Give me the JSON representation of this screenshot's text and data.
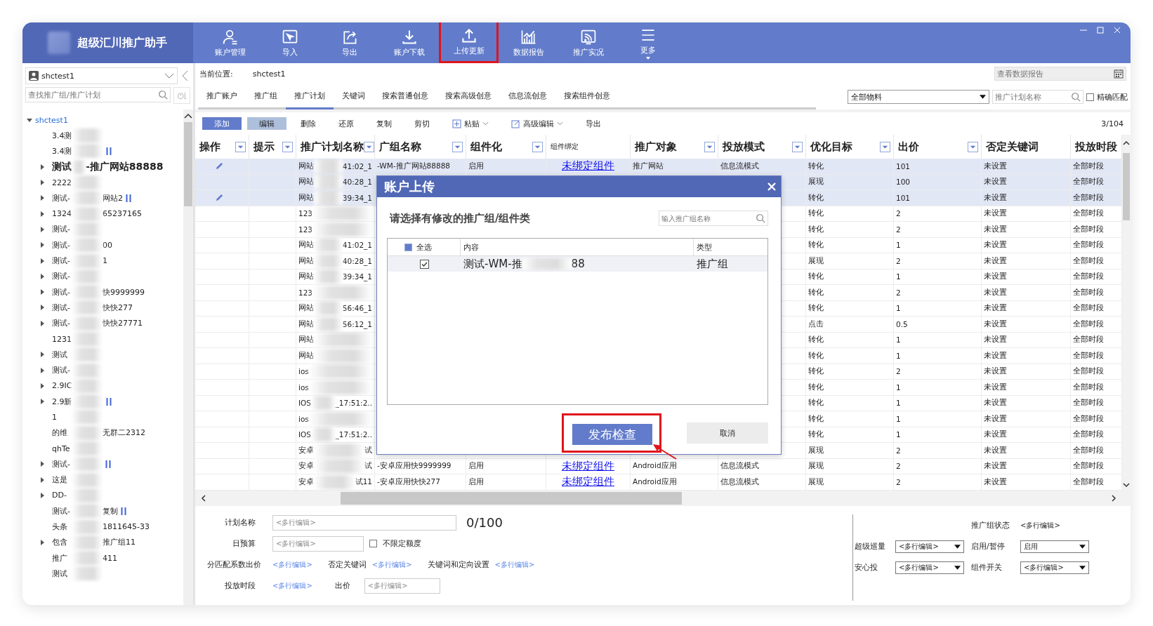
{
  "app": {
    "title": "超级汇川推广助手"
  },
  "toolbar": [
    {
      "label": "账户管理",
      "highlighted": false,
      "dropdown": false
    },
    {
      "label": "导入",
      "highlighted": false,
      "dropdown": false
    },
    {
      "label": "导出",
      "highlighted": false,
      "dropdown": false
    },
    {
      "label": "账户下载",
      "highlighted": false,
      "dropdown": false
    },
    {
      "label": "上传更新",
      "highlighted": true,
      "dropdown": false
    },
    {
      "label": "数据报告",
      "highlighted": false,
      "dropdown": false
    },
    {
      "label": "推广实况",
      "highlighted": false,
      "dropdown": false
    },
    {
      "label": "更多",
      "highlighted": false,
      "dropdown": true
    }
  ],
  "sidebar": {
    "account": "shctest1",
    "search_placeholder": "查找推广组/推广计划",
    "tree": {
      "label": "shctest1",
      "expanded": true,
      "children": [
        {
          "text": "3.4测",
          "expandable": false,
          "paused": false,
          "selected": false
        },
        {
          "text": "3.4测",
          "expandable": false,
          "paused": true,
          "selected": false
        },
        {
          "text": "测试",
          "tail": "-推广网站88888",
          "expandable": true,
          "paused": false,
          "selected": true
        },
        {
          "text": "2222",
          "expandable": true,
          "paused": false,
          "selected": false
        },
        {
          "text": "测试-",
          "tail": "网站2",
          "expandable": true,
          "paused": true,
          "selected": false
        },
        {
          "text": "1324",
          "tail": "65237165",
          "expandable": true,
          "paused": false,
          "selected": false
        },
        {
          "text": "测试-",
          "expandable": true,
          "paused": false,
          "selected": false
        },
        {
          "text": "测试-",
          "tail": "00",
          "expandable": true,
          "paused": false,
          "selected": false
        },
        {
          "text": "测试-",
          "tail": "1",
          "expandable": true,
          "paused": false,
          "selected": false
        },
        {
          "text": "测试-",
          "expandable": true,
          "paused": false,
          "selected": false
        },
        {
          "text": "测试-",
          "tail": "快9999999",
          "expandable": true,
          "paused": false,
          "selected": false
        },
        {
          "text": "测试-",
          "tail": "快快277",
          "expandable": true,
          "paused": false,
          "selected": false
        },
        {
          "text": "测试-",
          "tail": "快快27771",
          "expandable": true,
          "paused": false,
          "selected": false
        },
        {
          "text": "1231",
          "expandable": false,
          "paused": false,
          "selected": false
        },
        {
          "text": "测试",
          "expandable": true,
          "paused": false,
          "selected": false
        },
        {
          "text": "测试-",
          "expandable": true,
          "paused": false,
          "selected": false
        },
        {
          "text": "2.9IC",
          "expandable": true,
          "paused": false,
          "selected": false
        },
        {
          "text": "2.9新",
          "expandable": true,
          "paused": true,
          "selected": false
        },
        {
          "text": "1",
          "expandable": false,
          "paused": false,
          "selected": false
        },
        {
          "text": "的维",
          "tail": "无群二2312",
          "expandable": false,
          "paused": false,
          "selected": false
        },
        {
          "text": "qhTe",
          "expandable": false,
          "paused": false,
          "selected": false
        },
        {
          "text": "测试-",
          "expandable": true,
          "paused": true,
          "selected": false
        },
        {
          "text": "这是",
          "expandable": true,
          "paused": false,
          "selected": false
        },
        {
          "text": "DD-",
          "expandable": true,
          "paused": false,
          "selected": false
        },
        {
          "text": "测试-",
          "tail": "复制",
          "expandable": false,
          "paused": true,
          "selected": false
        },
        {
          "text": "头条",
          "tail": "1811645-33",
          "expandable": false,
          "paused": false,
          "selected": false
        },
        {
          "text": "包含",
          "tail": "推广组11",
          "expandable": true,
          "paused": false,
          "selected": false
        },
        {
          "text": "推广",
          "tail": "411",
          "expandable": false,
          "paused": false,
          "selected": false
        },
        {
          "text": "测试",
          "expandable": false,
          "paused": false,
          "selected": false
        }
      ]
    }
  },
  "location": {
    "label": "当前位置:",
    "value": "shctest1"
  },
  "report_field": {
    "placeholder": "查看数据报告"
  },
  "tabs": [
    {
      "label": "推广账户",
      "selected": false
    },
    {
      "label": "推广组",
      "selected": false
    },
    {
      "label": "推广计划",
      "selected": true
    },
    {
      "label": "关键词",
      "selected": false
    },
    {
      "label": "搜索普通创意",
      "selected": false
    },
    {
      "label": "搜索高级创意",
      "selected": false
    },
    {
      "label": "信息流创意",
      "selected": false
    },
    {
      "label": "搜索组件创意",
      "selected": false
    }
  ],
  "material_select": {
    "value": "全部物料"
  },
  "plan_search": {
    "placeholder": "推广计划名称"
  },
  "exact_match": {
    "label": "精确匹配",
    "checked": false
  },
  "actions": [
    {
      "label": "添加",
      "kind": "primary"
    },
    {
      "label": "编辑",
      "kind": "secondary"
    },
    {
      "label": "删除",
      "kind": "plain"
    },
    {
      "label": "还原",
      "kind": "plain"
    },
    {
      "label": "复制",
      "kind": "plain"
    },
    {
      "label": "剪切",
      "kind": "plain"
    },
    {
      "label": "粘贴",
      "kind": "menu"
    },
    {
      "label": "高级编辑",
      "kind": "menu"
    },
    {
      "label": "导出",
      "kind": "plain"
    }
  ],
  "page_count": "3/104",
  "table": {
    "columns": [
      {
        "label": "操作",
        "filter": true,
        "compact": false
      },
      {
        "label": "提示",
        "filter": true,
        "compact": false
      },
      {
        "label": "推广计划名称",
        "filter": true,
        "compact": false
      },
      {
        "label": "广组名称",
        "filter": true,
        "compact": false
      },
      {
        "label": "组件化",
        "filter": true,
        "compact": false
      },
      {
        "label": "组件绑定",
        "filter": false,
        "compact": true
      },
      {
        "label": "推广对象",
        "filter": true,
        "compact": false
      },
      {
        "label": "投放模式",
        "filter": true,
        "compact": false
      },
      {
        "label": "优化目标",
        "filter": true,
        "compact": false
      },
      {
        "label": "出价",
        "filter": true,
        "compact": false
      },
      {
        "label": "否定关键词",
        "filter": false,
        "compact": false
      },
      {
        "label": "投放时段",
        "filter": false,
        "compact": false
      }
    ],
    "rows": [
      {
        "selected": true,
        "editing": true,
        "plan": "网站",
        "plan_end": "41:02_1",
        "group": "-WM-推广网站88888",
        "componentized": "启用",
        "binding": "未绑定组件",
        "target": "推广网站",
        "mode": "信息流模式",
        "goal": "转化",
        "bid": "101",
        "negative": "未设置",
        "time": "全部时段"
      },
      {
        "selected": true,
        "editing": false,
        "plan": "网站",
        "plan_end": "40:28_1",
        "goal": "展现",
        "bid": "100",
        "negative": "未设置",
        "time": "全部时段"
      },
      {
        "selected": true,
        "editing": true,
        "plan": "网站",
        "plan_end": "39:34_1",
        "goal": "转化",
        "bid": "101",
        "negative": "未设置",
        "time": "全部时段"
      },
      {
        "selected": false,
        "editing": false,
        "plan": "123",
        "goal": "转化",
        "bid": "2",
        "negative": "未设置",
        "time": "全部时段"
      },
      {
        "selected": false,
        "editing": false,
        "plan": "123",
        "goal": "转化",
        "bid": "2",
        "negative": "未设置",
        "time": "全部时段"
      },
      {
        "selected": false,
        "editing": false,
        "plan": "网站",
        "plan_end": "41:02_1",
        "goal": "转化",
        "bid": "1",
        "negative": "未设置",
        "time": "全部时段"
      },
      {
        "selected": false,
        "editing": false,
        "plan": "网站",
        "plan_end": "40:28_1",
        "goal": "展现",
        "bid": "2",
        "negative": "未设置",
        "time": "全部时段"
      },
      {
        "selected": false,
        "editing": false,
        "plan": "网站",
        "plan_end": "39:34_1",
        "goal": "转化",
        "bid": "1",
        "negative": "未设置",
        "time": "全部时段"
      },
      {
        "selected": false,
        "editing": false,
        "plan": "123",
        "goal": "转化",
        "bid": "2",
        "negative": "未设置",
        "time": "全部时段"
      },
      {
        "selected": false,
        "editing": false,
        "plan": "网站",
        "plan_end": "56:46_1",
        "goal": "转化",
        "bid": "1",
        "negative": "未设置",
        "time": "全部时段"
      },
      {
        "selected": false,
        "editing": false,
        "plan": "网站",
        "plan_end": "56:12_1",
        "goal": "点击",
        "bid": "0.5",
        "negative": "未设置",
        "time": "全部时段"
      },
      {
        "selected": false,
        "editing": false,
        "plan": "网站",
        "goal": "转化",
        "bid": "1",
        "negative": "未设置",
        "time": "全部时段"
      },
      {
        "selected": false,
        "editing": false,
        "plan": "网站",
        "goal": "转化",
        "bid": "1",
        "negative": "未设置",
        "time": "全部时段"
      },
      {
        "selected": false,
        "editing": false,
        "plan": "ios",
        "goal": "转化",
        "bid": "2",
        "negative": "未设置",
        "time": "全部时段"
      },
      {
        "selected": false,
        "editing": false,
        "plan": "ios",
        "goal": "转化",
        "bid": "1",
        "negative": "未设置",
        "time": "全部时段"
      },
      {
        "selected": false,
        "editing": false,
        "plan": "IOS",
        "plan_end": "_17:51:2..",
        "goal": "转化",
        "bid": "1",
        "negative": "未设置",
        "time": "全部时段"
      },
      {
        "selected": false,
        "editing": false,
        "plan": "ios",
        "goal": "转化",
        "bid": "1",
        "negative": "未设置",
        "time": "全部时段"
      },
      {
        "selected": false,
        "editing": false,
        "plan": "IOS",
        "plan_end": "_17:51:2..",
        "goal": "转化",
        "bid": "1",
        "negative": "未设置",
        "time": "全部时段"
      },
      {
        "selected": false,
        "editing": false,
        "plan": "安卓",
        "plan_end": "试",
        "goal": "展现",
        "bid": "2",
        "negative": "未设置",
        "time": "全部时段"
      },
      {
        "selected": false,
        "editing": false,
        "plan": "安卓",
        "plan_end": "试",
        "group": "-安卓应用快9999999",
        "componentized": "启用",
        "binding": "未绑定组件",
        "target": "Android应用",
        "mode": "信息流模式",
        "goal": "展现",
        "bid": "2",
        "negative": "未设置",
        "time": "全部时段"
      },
      {
        "selected": false,
        "editing": false,
        "plan": "安卓",
        "plan_end": "试11",
        "group": "-安卓应用快快277",
        "componentized": "启用",
        "binding": "未绑定组件",
        "target": "Android应用",
        "mode": "信息流模式",
        "goal": "展现",
        "bid": "2",
        "negative": "未设置",
        "time": "全部时段"
      }
    ]
  },
  "form": {
    "plan_name": {
      "label": "计划名称",
      "placeholder": "<多行编辑>",
      "counter": "0/100"
    },
    "budget": {
      "label": "日预算",
      "placeholder": "<多行编辑>",
      "unlimited": {
        "label": "不限定额度",
        "checked": false
      }
    },
    "links": [
      {
        "label": "分匹配系数出价",
        "value": "<多行编辑>"
      },
      {
        "label": "否定关键词",
        "value": "<多行编辑>"
      },
      {
        "label": "关键词和定向设置",
        "value": "<多行编辑>"
      }
    ],
    "schedule": {
      "label": "投放时段",
      "value": "<多行编辑>"
    },
    "bid": {
      "label": "出价",
      "placeholder": "<多行编辑>"
    },
    "status": {
      "label": "推广组状态",
      "value": "<多行编辑>"
    },
    "selects": [
      {
        "label": "超级巡量",
        "value": "<多行编辑>"
      },
      {
        "label": "启用/暂停",
        "value": "启用"
      },
      {
        "label": "安心投",
        "value": "<多行编辑>"
      },
      {
        "label": "组件开关",
        "value": "<多行编辑>"
      }
    ]
  },
  "dialog": {
    "title": "账户上传",
    "subtitle": "请选择有修改的推广组/组件类",
    "search_placeholder": "输入推广组名称",
    "select_all": {
      "label": "全选",
      "checked": true
    },
    "columns": [
      "内容",
      "类型"
    ],
    "rows": [
      {
        "checked": true,
        "content": "测试-WM-推",
        "content_end": "88",
        "type": "推广组"
      }
    ],
    "buttons": [
      {
        "label": "发布检查",
        "kind": "primary",
        "highlighted": true
      },
      {
        "label": "取消",
        "kind": "secondary",
        "highlighted": false
      }
    ]
  }
}
